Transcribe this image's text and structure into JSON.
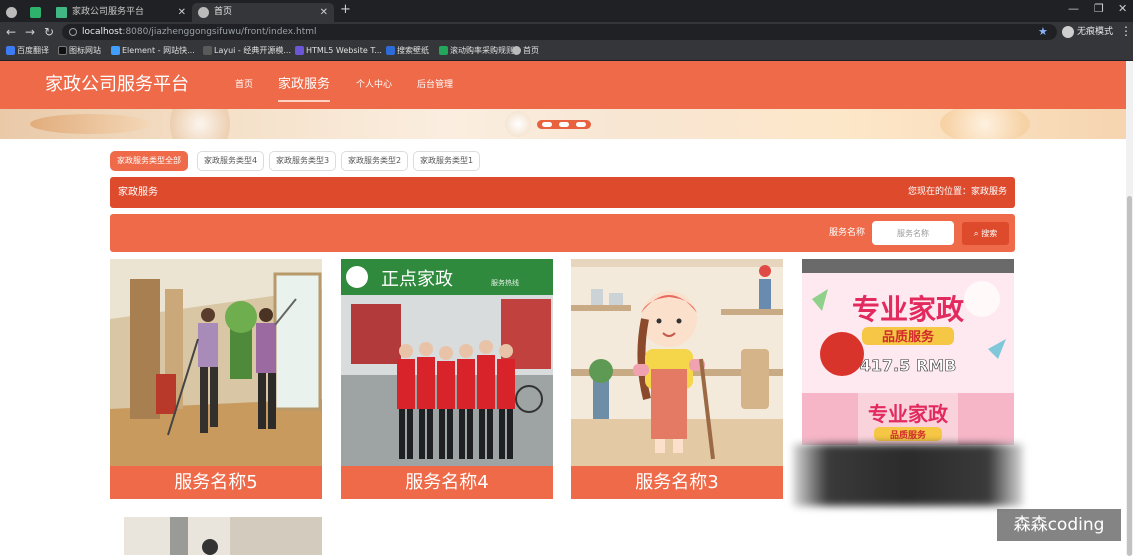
{
  "browser": {
    "tabs": [
      {
        "label": "家政公司服务平台",
        "active": false
      },
      {
        "label": "首页",
        "active": true
      }
    ],
    "new_tab_symbol": "+",
    "url_host": "localhost",
    "url_rest": ":8080/jiazhenggongsifuwu/front/index.html",
    "profile_label": "无痕模式",
    "bookmarks": [
      "百度翻译",
      "图标网站",
      "Element - 网站快...",
      "Layui - 经典开源模...",
      "HTML5 Website T...",
      "搜索壁纸",
      "滚动购率采购规则",
      "首页"
    ]
  },
  "site": {
    "brand": "家政公司服务平台",
    "nav": [
      {
        "label": "首页",
        "active": false
      },
      {
        "label": "家政服务",
        "active": true
      },
      {
        "label": "个人中心",
        "active": false
      },
      {
        "label": "后台管理",
        "active": false
      }
    ]
  },
  "categories": [
    {
      "label": "家政服务类型全部",
      "active": true
    },
    {
      "label": "家政服务类型4",
      "active": false
    },
    {
      "label": "家政服务类型3",
      "active": false
    },
    {
      "label": "家政服务类型2",
      "active": false
    },
    {
      "label": "家政服务类型1",
      "active": false
    }
  ],
  "titlebar": {
    "title": "家政服务",
    "location": "您现在的位置：家政服务"
  },
  "search": {
    "label": "服务名称",
    "placeholder": "服务名称",
    "button": "搜索"
  },
  "cards": [
    {
      "caption": "服务名称5"
    },
    {
      "caption": "服务名称4",
      "shop_sign": "正点家政",
      "shop_sub": "服务热线"
    },
    {
      "caption": "服务名称3"
    },
    {
      "caption": "",
      "poster_title": "专业家政",
      "poster_sub": "品质服务",
      "price": "417.5 RMB",
      "poster_title_2": "专业家政",
      "poster_sub_2": "品质服务"
    }
  ],
  "watermark": "森森coding",
  "colors": {
    "primary": "#ee6a49",
    "primary_dark": "#dd4a2c",
    "browser_dark": "#202124",
    "browser_mid": "#35363a"
  }
}
